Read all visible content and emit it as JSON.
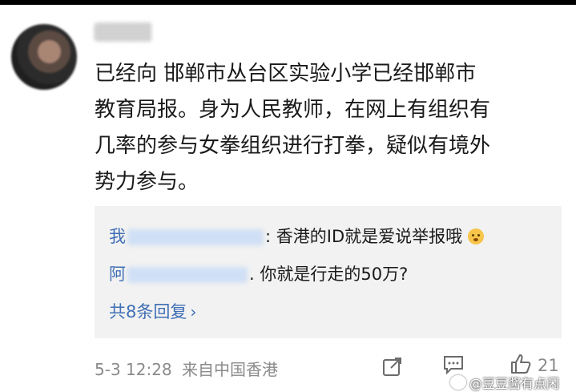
{
  "comment": {
    "lines": [
      "已经向 邯郸市丛台区实验小学已经邯郸市",
      "教育局报。身为人民教师，在网上有组织有",
      "几率的参与女拳组织进行打拳，疑似有境外",
      "势力参与。"
    ]
  },
  "replies": [
    {
      "name_prefix": "我",
      "name_suffix": "",
      "text": ": 香港的ID就是爱说举报哦"
    },
    {
      "name_prefix": "阿",
      "name_suffix": "",
      "text": ". 你就是行走的50万?"
    }
  ],
  "more_replies": "共8条回复",
  "meta": {
    "timestamp": "5-3 12:28",
    "source": "来自中国香港"
  },
  "actions": {
    "like_count": "21"
  },
  "watermark": "@豆豆酱有点闲",
  "colors": {
    "link": "#3f6fb5",
    "reply_bg": "#f2f2f2",
    "meta": "#8a8a8a"
  }
}
